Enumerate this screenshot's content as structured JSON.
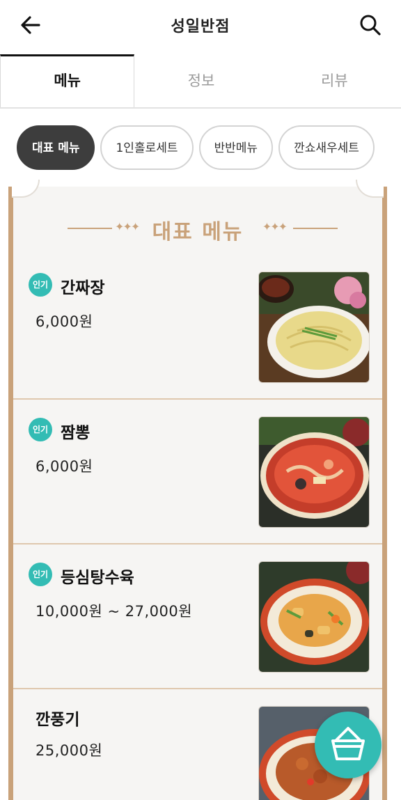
{
  "header": {
    "title": "성일반점",
    "back_icon": "arrow-left-icon",
    "search_icon": "search-icon"
  },
  "tabs": [
    {
      "label": "메뉴",
      "active": true
    },
    {
      "label": "정보",
      "active": false
    },
    {
      "label": "리뷰",
      "active": false
    }
  ],
  "categories": [
    {
      "label": "대표 메뉴",
      "active": true
    },
    {
      "label": "1인홀로세트",
      "active": false
    },
    {
      "label": "반반메뉴",
      "active": false
    },
    {
      "label": "깐쇼새우세트",
      "active": false
    }
  ],
  "section": {
    "title": "대표 메뉴"
  },
  "menu_items": [
    {
      "badge": "인기",
      "name": "간짜장",
      "price": "6,000원",
      "image": "jajangmyeon-photo"
    },
    {
      "badge": "인기",
      "name": "짬뽕",
      "price": "6,000원",
      "image": "jjamppong-photo"
    },
    {
      "badge": "인기",
      "name": "등심탕수육",
      "price": "10,000원 ~ 27,000원",
      "image": "tangsuyuk-photo"
    },
    {
      "badge": "",
      "name": "깐풍기",
      "price": "25,000원",
      "image": "kkanpunggi-photo"
    }
  ],
  "cart": {
    "icon": "basket-icon"
  },
  "colors": {
    "accent_teal": "#33bcb4",
    "gold": "#c9a27a",
    "chip_active": "#3d3d3d",
    "board_bg": "#f6f5f3"
  }
}
